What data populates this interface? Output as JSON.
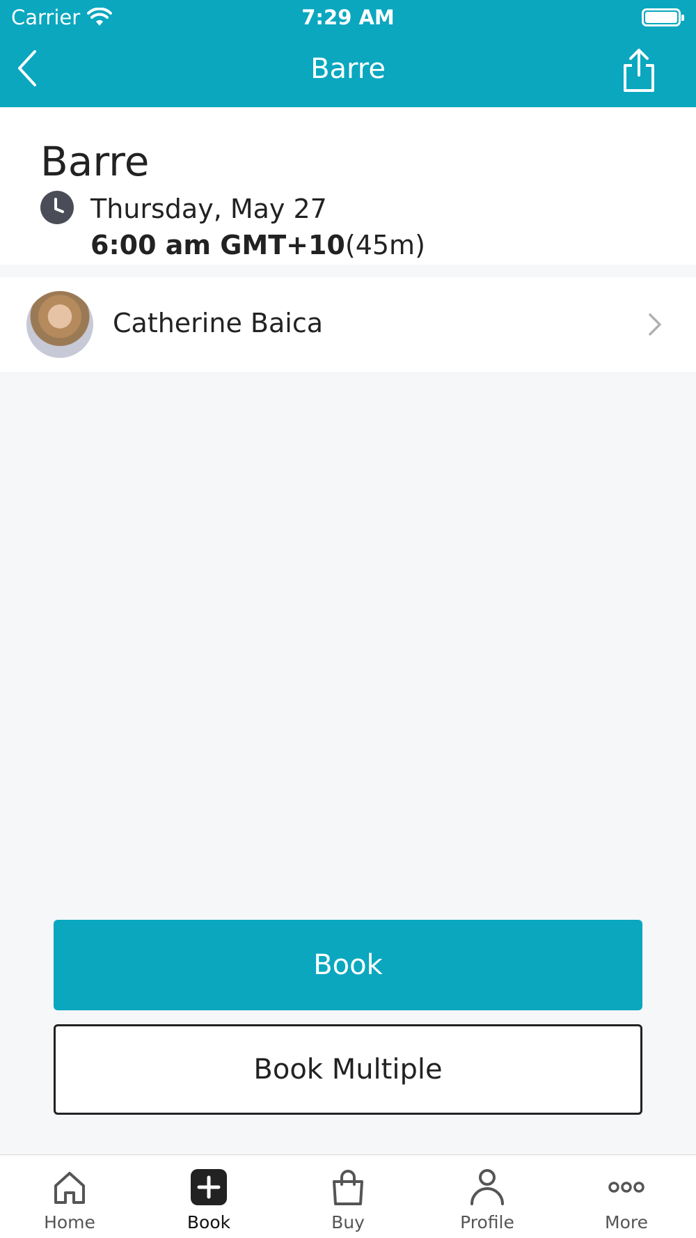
{
  "status_bar": {
    "carrier": "Carrier",
    "time": "7:29 AM"
  },
  "nav": {
    "title": "Barre"
  },
  "class_info": {
    "title": "Barre",
    "date": "Thursday, May 27",
    "time_bold": "6:00 am GMT+10",
    "duration": "(45m)"
  },
  "instructor": {
    "name": "Catherine Baica"
  },
  "actions": {
    "book_label": "Book",
    "book_multiple_label": "Book Multiple"
  },
  "tabbar": {
    "tabs": [
      {
        "label": "Home",
        "icon": "home-icon"
      },
      {
        "label": "Book",
        "icon": "plus-square-icon",
        "active": true
      },
      {
        "label": "Buy",
        "icon": "shopping-bag-icon"
      },
      {
        "label": "Profile",
        "icon": "person-icon"
      },
      {
        "label": "More",
        "icon": "more-dots-icon"
      }
    ]
  },
  "colors": {
    "accent": "#0aa7bf",
    "text": "#222222",
    "background": "#f6f7f9"
  }
}
